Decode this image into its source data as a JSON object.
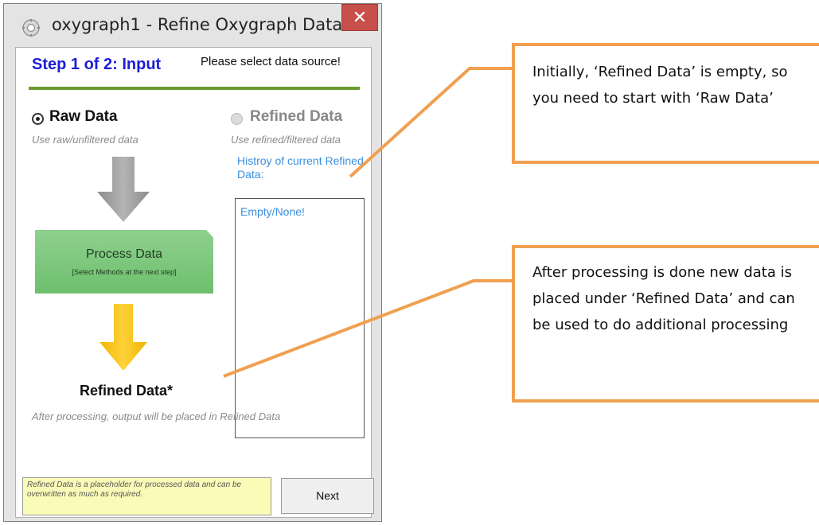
{
  "window": {
    "title": "oxygraph1 - Refine Oxygraph Data",
    "close_glyph": "✕",
    "icon": "gear-icon"
  },
  "step": {
    "title": "Step 1 of 2: Input",
    "hint": "Please select data source!"
  },
  "raw": {
    "label": "Raw Data",
    "sub": "Use raw/unfiltered data",
    "selected": true
  },
  "refined": {
    "label": "Refined Data",
    "sub": "Use refined/filtered data",
    "enabled": false,
    "history_label": "Histroy of current Refined Data:",
    "history_items": [
      "Empty/None!"
    ]
  },
  "process": {
    "title": "Process Data",
    "sub": "[Select Methods at the next step]"
  },
  "output": {
    "title": "Refined Data*",
    "sub": "After processing, output will be placed in Refined Data"
  },
  "note": "Refined Data is a placeholder for processed data and can be overwritten as much as required.",
  "next_button": "Next",
  "callouts": [
    {
      "text": "Initially, ‘Refined Data’ is empty, so you need to start with ‘Raw Data’"
    },
    {
      "text": "After processing is done new data is placed under ‘Refined Data’ and can be used to do additional processing"
    }
  ],
  "colors": {
    "step_title": "#1c1cd6",
    "accent_green": "#6a9a2d",
    "history_blue": "#3a8fe0",
    "callout_border": "#f0a050",
    "close_red": "#c7504b",
    "note_yellow": "#fbfbb8"
  }
}
